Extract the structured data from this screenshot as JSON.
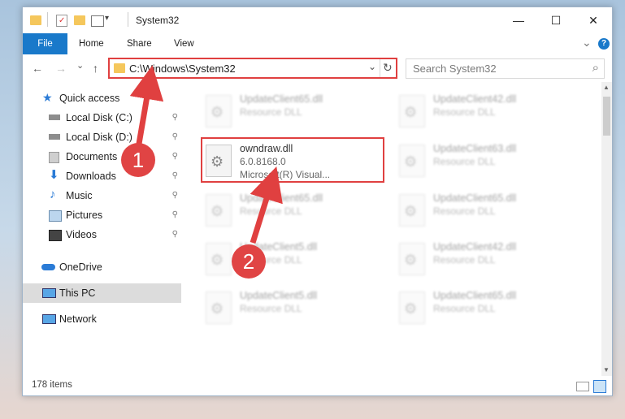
{
  "window": {
    "title": "System32",
    "minimize": "—",
    "maximize": "☐",
    "close": "✕"
  },
  "ribbon": {
    "tabs": [
      "File",
      "Home",
      "Share",
      "View"
    ],
    "expand": "⌄",
    "help": "?"
  },
  "nav": {
    "back": "←",
    "forward": "→",
    "recent": "⌄",
    "up": "↑",
    "address": "C:\\Windows\\System32",
    "address_dropdown": "⌄",
    "refresh": "↻",
    "search_placeholder": "Search System32",
    "search_icon": "⌕"
  },
  "sidebar": {
    "quick_access": "Quick access",
    "items": [
      {
        "label": "Local Disk (C:)",
        "icon": "drive-icon",
        "pinned": true
      },
      {
        "label": "Local Disk (D:)",
        "icon": "drive-icon",
        "pinned": true
      },
      {
        "label": "Documents",
        "icon": "documents-icon",
        "pinned": true
      },
      {
        "label": "Downloads",
        "icon": "downloads-icon",
        "pinned": true
      },
      {
        "label": "Music",
        "icon": "music-icon",
        "pinned": true
      },
      {
        "label": "Pictures",
        "icon": "pictures-icon",
        "pinned": true
      },
      {
        "label": "Videos",
        "icon": "videos-icon",
        "pinned": true
      }
    ],
    "onedrive": "OneDrive",
    "thispc": "This PC",
    "network": "Network",
    "pin_glyph": "📌"
  },
  "files": {
    "highlighted": {
      "name": "owndraw.dll",
      "version": "6.0.8168.0",
      "company": "Microsoft(R) Visual..."
    },
    "blurred": [
      {
        "name": "UpdateClient65.dll",
        "type": "Resource DLL"
      },
      {
        "name": "UpdateClient42.dll",
        "type": "Resource DLL"
      },
      {
        "name": "UpdateClient63.dll",
        "type": "Resource DLL"
      },
      {
        "name": "UpdateClient65.dll",
        "type": "Resource DLL"
      },
      {
        "name": "UpdateClient65.dll",
        "type": "Resource DLL"
      },
      {
        "name": "UpdateClient5.dll",
        "type": "Resource DLL"
      },
      {
        "name": "UpdateClient42.dll",
        "type": "Resource DLL"
      },
      {
        "name": "UpdateClient5.dll",
        "type": "Resource DLL"
      },
      {
        "name": "UpdateClient65.dll",
        "type": "Resource DLL"
      }
    ]
  },
  "status": {
    "item_count": "178 items"
  },
  "callouts": {
    "one": "1",
    "two": "2"
  },
  "colors": {
    "accent": "#1979ca",
    "callout": "#e04040",
    "folder": "#f5c75c"
  }
}
